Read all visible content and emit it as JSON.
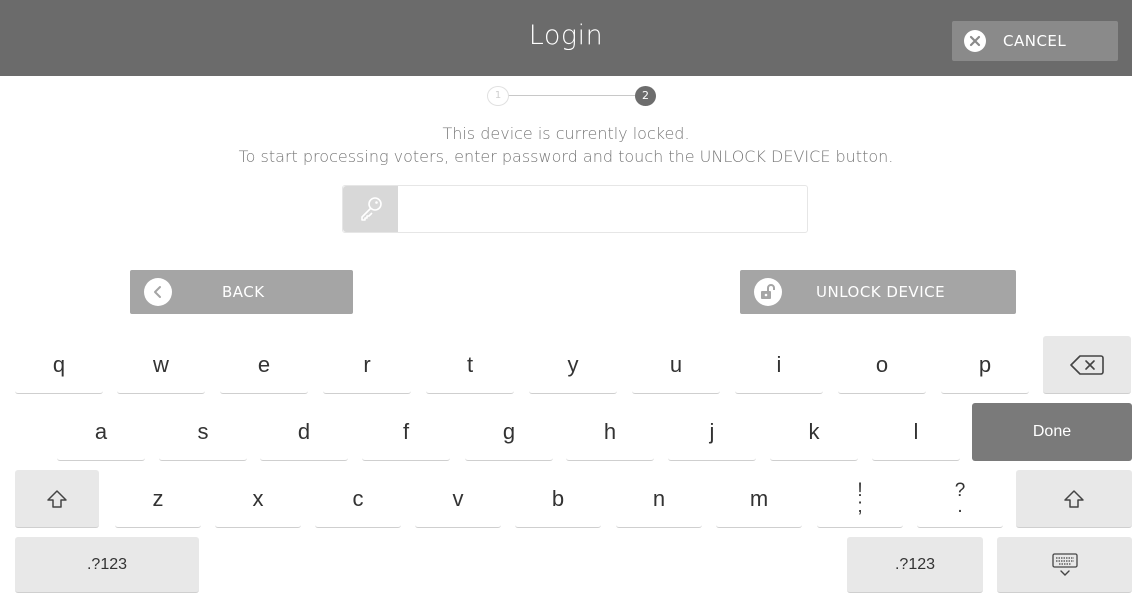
{
  "header": {
    "title": "Login",
    "cancel_label": "CANCEL"
  },
  "stepper": {
    "step1": "1",
    "step2": "2"
  },
  "message": {
    "line1": "This device is currently locked.",
    "line2": "To start processing voters, enter password and touch the UNLOCK DEVICE button."
  },
  "password": {
    "value": "",
    "placeholder": ""
  },
  "buttons": {
    "back_label": "BACK",
    "unlock_label": "UNLOCK DEVICE"
  },
  "keyboard": {
    "row1": [
      "q",
      "w",
      "e",
      "r",
      "t",
      "y",
      "u",
      "i",
      "o",
      "p"
    ],
    "row2": [
      "a",
      "s",
      "d",
      "f",
      "g",
      "h",
      "j",
      "k",
      "l"
    ],
    "row3": [
      "z",
      "x",
      "c",
      "v",
      "b",
      "n",
      "m"
    ],
    "punct1_top": "!",
    "punct1_bottom": ";",
    "punct2_top": "?",
    "punct2_bottom": ".",
    "done_label": "Done",
    "sym_left": ".?123",
    "sym_right": ".?123"
  },
  "colors": {
    "header_bg": "#6b6b6b",
    "button_bg": "#a5a5a5",
    "done_bg": "#7a7a7a"
  },
  "icons": [
    "close-icon",
    "key-icon",
    "chevron-left-icon",
    "unlock-icon",
    "backspace-icon",
    "shift-icon",
    "keyboard-hide-icon"
  ]
}
